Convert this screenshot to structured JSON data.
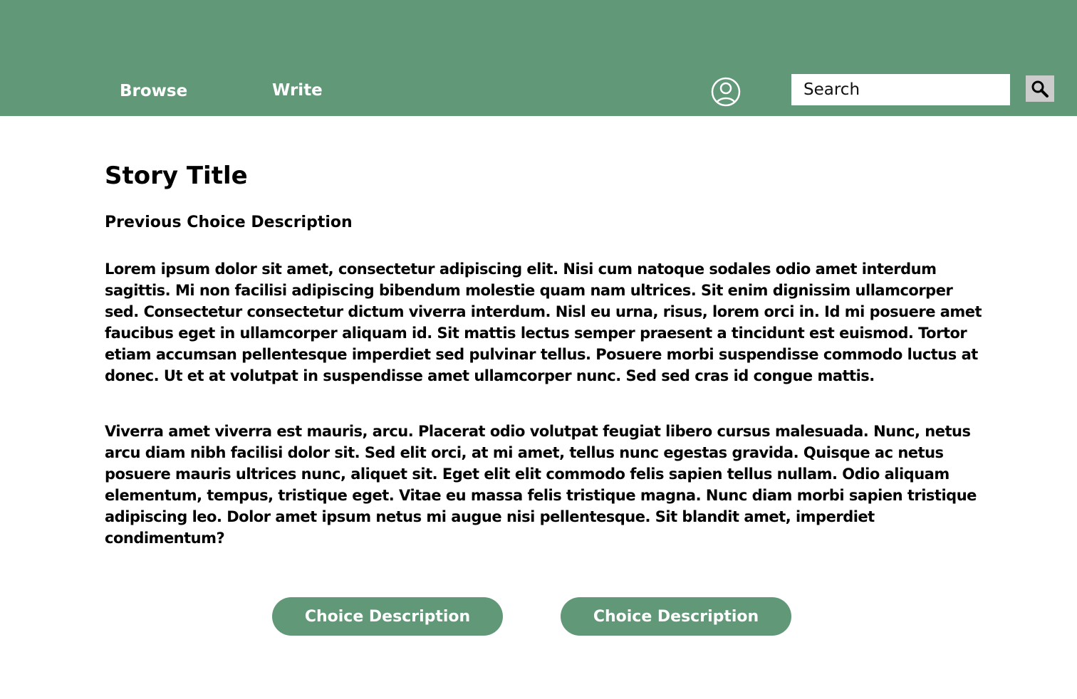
{
  "header": {
    "nav": {
      "browse_label": "Browse",
      "write_label": "Write"
    },
    "profile_icon": "user-circle-icon",
    "search": {
      "placeholder": "Search",
      "value": "",
      "button_icon": "magnifier-icon"
    }
  },
  "story": {
    "title": "Story Title",
    "previous_choice": "Previous Choice Description",
    "paragraphs": [
      "Lorem ipsum dolor sit amet, consectetur adipiscing elit. Nisi cum natoque sodales odio amet interdum sagittis. Mi non facilisi adipiscing bibendum molestie quam nam ultrices. Sit enim dignissim ullamcorper sed. Consectetur consectetur dictum viverra interdum. Nisl eu urna, risus, lorem orci in. Id mi posuere amet faucibus eget in ullamcorper aliquam id. Sit mattis lectus semper praesent a tincidunt est euismod. Tortor etiam accumsan pellentesque imperdiet sed pulvinar tellus. Posuere morbi suspendisse commodo luctus at donec. Ut et at volutpat in suspendisse amet ullamcorper nunc. Sed sed cras id congue mattis.",
      "Viverra amet viverra est mauris, arcu. Placerat odio volutpat feugiat libero cursus malesuada. Nunc, netus arcu diam nibh facilisi dolor sit. Sed elit orci, at mi amet, tellus nunc egestas gravida. Quisque ac netus posuere mauris ultrices nunc, aliquet sit. Eget elit elit commodo felis sapien tellus nullam. Odio aliquam elementum, tempus, tristique eget. Vitae eu massa felis tristique magna. Nunc diam morbi sapien tristique adipiscing leo. Dolor amet ipsum netus mi augue nisi pellentesque. Sit blandit amet, imperdiet condimentum?"
    ],
    "choices": [
      {
        "label": "Choice Description"
      },
      {
        "label": "Choice Description"
      }
    ]
  },
  "colors": {
    "brand_green": "#619878",
    "search_button_bg": "#cccccc",
    "background": "#ffffff"
  }
}
